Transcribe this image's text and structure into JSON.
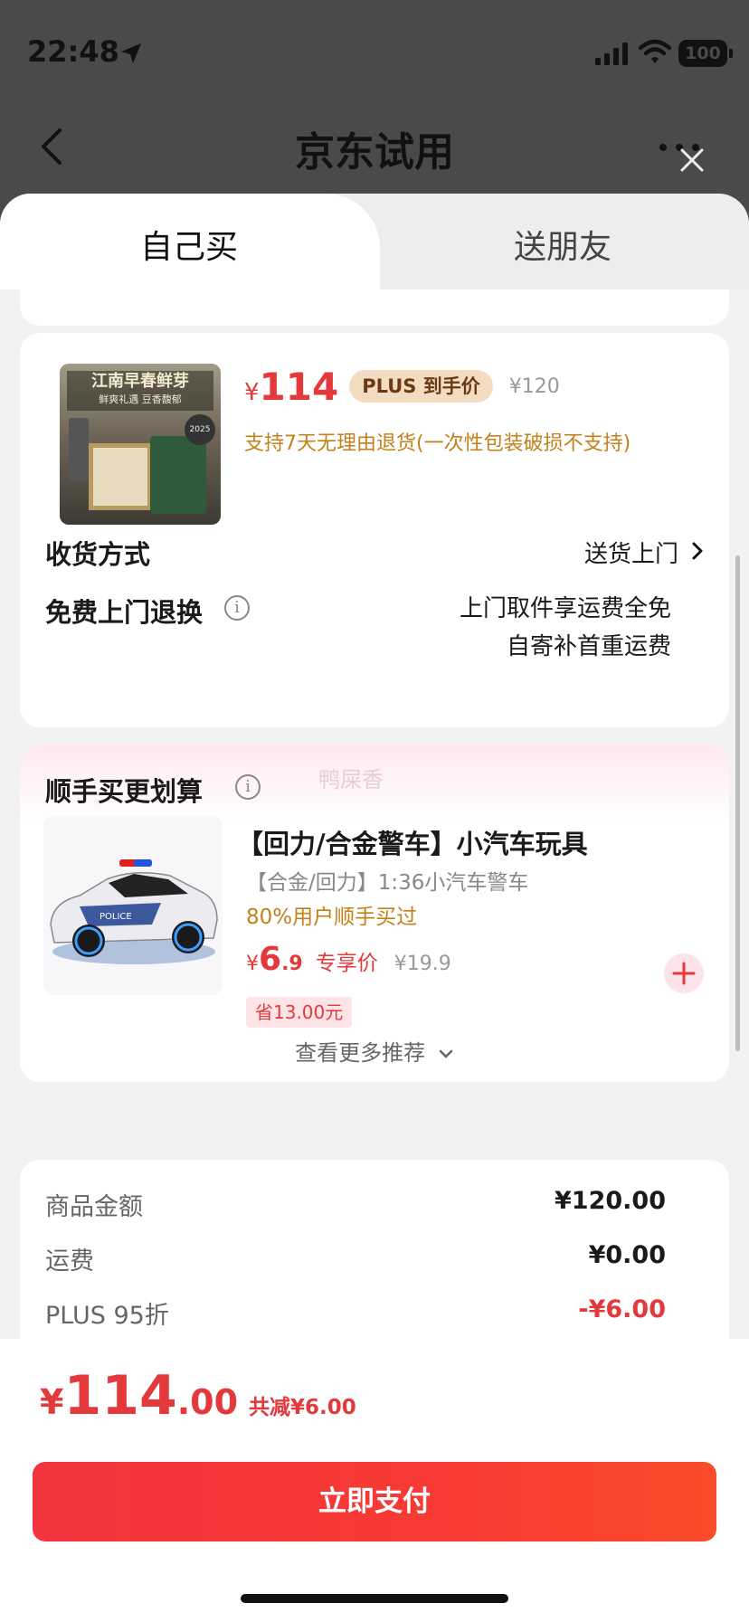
{
  "status_bar": {
    "time": "22:48",
    "battery": "100"
  },
  "nav": {
    "title": "京东试用"
  },
  "tabs": [
    {
      "label": "自己买",
      "active": true
    },
    {
      "label": "送朋友",
      "active": false
    }
  ],
  "product": {
    "image_banner": "江南早春鲜芽",
    "image_sub": "鲜爽礼遇 豆香馥郁",
    "image_year": "2025",
    "price_symbol": "¥",
    "price": "114",
    "plus_badge": "PLUS 到手价",
    "original_price": "¥120",
    "return_policy": "支持7天无理由退货(一次性包装破损不支持)"
  },
  "delivery": {
    "label": "收货方式",
    "value": "送货上门"
  },
  "free_return": {
    "label": "免费上门退换",
    "value_line1": "上门取件享运费全免",
    "value_line2": "自寄补首重运费"
  },
  "addon": {
    "title": "顺手买更划算",
    "hint": "鸭屎香",
    "name": "【回力/合金警车】小汽车玩具",
    "spec": "【合金/回力】1:36小汽车警车",
    "bought": "80%用户顺手买过",
    "price_symbol": "¥",
    "price_int": "6",
    "price_dec": ".9",
    "price_tag": "专享价",
    "original_price": "¥19.9",
    "save": "省13.00元",
    "see_more": "查看更多推荐"
  },
  "summary": [
    {
      "label": "商品金额",
      "value": "¥120.00",
      "highlight": false
    },
    {
      "label": "运费",
      "value": "¥0.00",
      "highlight": false
    },
    {
      "label": "PLUS 95折",
      "value": "-¥6.00",
      "highlight": true
    }
  ],
  "pay": {
    "total_symbol": "¥",
    "total_int": "114",
    "total_dec": ".00",
    "discount": "共减¥6.00",
    "button": "立即支付"
  },
  "colors": {
    "accent": "#e4393c",
    "gold_text": "#c48019",
    "plus_badge_bg": "#f4dcc3"
  }
}
